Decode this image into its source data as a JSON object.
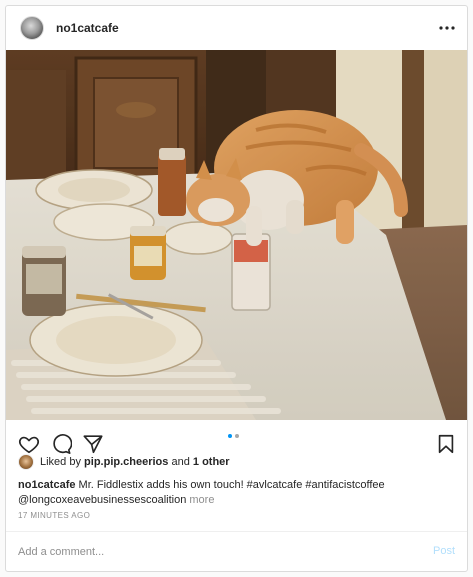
{
  "post": {
    "username": "no1catcafe",
    "photo_description": "Vintage photo: an orange and white cat standing on a dinner table with plates, jars and a glass"
  },
  "header": {
    "avatar_icon": "profile-avatar",
    "more_icon": "more-horizontal-icon"
  },
  "actions": {
    "like_icon": "heart-icon",
    "comment_icon": "comment-icon",
    "share_icon": "paper-plane-icon",
    "save_icon": "bookmark-icon",
    "carousel": {
      "count": 2,
      "active": 1
    }
  },
  "likes": {
    "prefix": "Liked by",
    "user": "pip.pip.cheerios",
    "connector": "and",
    "others": "1 other"
  },
  "caption": {
    "username": "no1catcafe",
    "text": "Mr. Fiddlestix adds his own touch! #avlcatcafe #antifacistcoffee",
    "text_line2": "@longcoxeavebusinessescoalition",
    "more_label": "more"
  },
  "timestamp": "17 MINUTES AGO",
  "comment": {
    "placeholder": "Add a comment...",
    "value": "",
    "post_label": "Post"
  },
  "colors": {
    "accent": "#0095f6",
    "post_disabled": "#b2dffc",
    "muted": "#8e8e8e"
  }
}
